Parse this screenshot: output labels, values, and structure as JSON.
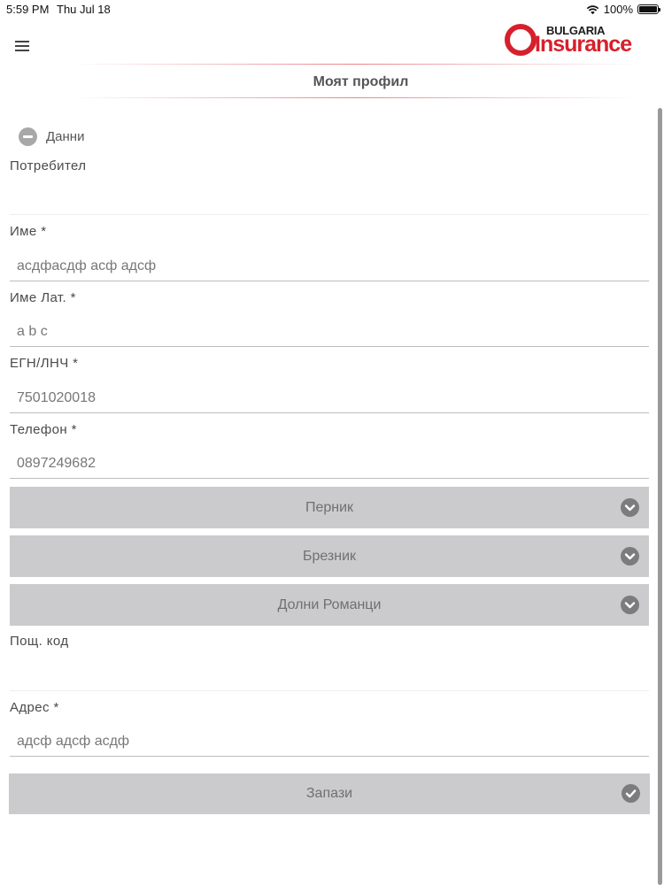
{
  "status_bar": {
    "time": "5:59 PM",
    "date": "Thu Jul 18",
    "battery": "100%"
  },
  "header": {
    "logo_top": "BULGARIA",
    "logo_bottom": "Insurance",
    "page_title": "Моят профил",
    "brand_color": "#d6202b"
  },
  "section": {
    "label": "Данни"
  },
  "fields": {
    "user": {
      "label": "Потребител",
      "value": ""
    },
    "name": {
      "label": "Име *",
      "value": "асдфасдф асф адсф"
    },
    "name_lat": {
      "label": "Име Лат. *",
      "value": "a b c"
    },
    "egn": {
      "label": "ЕГН/ЛНЧ *",
      "value": "7501020018"
    },
    "phone": {
      "label": "Телефон *",
      "value": "0897249682"
    },
    "postal_code": {
      "label": "Пощ. код",
      "value": ""
    },
    "address": {
      "label": "Адрес *",
      "value": "адсф адсф асдф"
    }
  },
  "selects": {
    "region": "Перник",
    "municipality": "Брезник",
    "settlement": "Долни Романци"
  },
  "actions": {
    "save_label": "Запази"
  },
  "icons": {
    "menu": "hamburger-icon",
    "section_toggle": "minus-circle-icon",
    "dropdown": "chevron-down-circle-icon",
    "save": "checkmark-circle-icon"
  }
}
